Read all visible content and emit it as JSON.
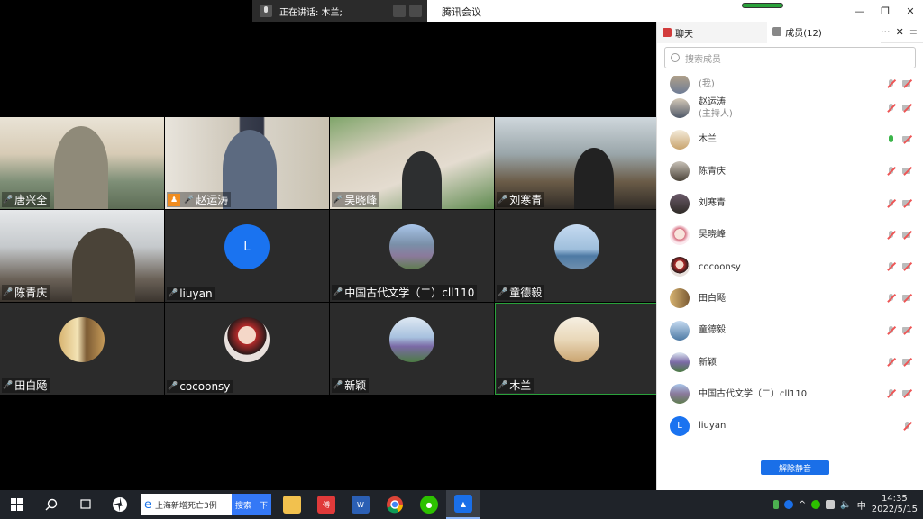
{
  "titlebar": {
    "speaking_label": "正在讲话: 木兰;",
    "app_title": "腾讯会议",
    "minimize": "—",
    "restore": "❐",
    "close": "✕"
  },
  "grid": {
    "tiles": [
      {
        "name": "唐兴全",
        "mic": "muted"
      },
      {
        "name": "赵运涛",
        "mic": "muted",
        "host": true
      },
      {
        "name": "吴晓峰",
        "mic": "muted"
      },
      {
        "name": "刘寒青",
        "mic": "muted"
      },
      {
        "name": "陈青庆",
        "mic": "muted"
      },
      {
        "name": "liuyan",
        "mic": "muted",
        "avatar_letter": "L"
      },
      {
        "name": "中国古代文学（二）cll110",
        "mic": "muted"
      },
      {
        "name": "童德毅",
        "mic": "muted"
      },
      {
        "name": "田白飏",
        "mic": "muted"
      },
      {
        "name": "cocoonsy",
        "mic": "muted"
      },
      {
        "name": "新颖",
        "mic": "muted"
      },
      {
        "name": "木兰",
        "mic": "on"
      }
    ]
  },
  "panel": {
    "chat_tab": "聊天",
    "members_tab": "成员(12)",
    "more": "···",
    "close": "✕",
    "menu": "≡",
    "search_placeholder": "搜索成员",
    "members": [
      {
        "name": "",
        "sub": "(我)"
      },
      {
        "name": "赵运涛",
        "sub": "(主持人)"
      },
      {
        "name": "木兰",
        "sub": ""
      },
      {
        "name": "陈青庆",
        "sub": ""
      },
      {
        "name": "刘寒青",
        "sub": ""
      },
      {
        "name": "吴晓峰",
        "sub": ""
      },
      {
        "name": "cocoonsy",
        "sub": ""
      },
      {
        "name": "田白飏",
        "sub": ""
      },
      {
        "name": "童德毅",
        "sub": ""
      },
      {
        "name": "新颖",
        "sub": ""
      },
      {
        "name": "中国古代文学（二）cll110",
        "sub": ""
      },
      {
        "name": "liuyan",
        "sub": "",
        "avatar_letter": "L"
      }
    ],
    "unmute_button": "解除静音"
  },
  "taskbar": {
    "search_text": "上海新增死亡3例",
    "search_button": "搜索一下",
    "time": "14:35",
    "date": "2022/5/15",
    "ime": "中"
  },
  "colors": {
    "accent": "#1a6fe8",
    "mic_on": "#3bb54a",
    "muted": "#e55555",
    "host": "#f08c1e"
  }
}
